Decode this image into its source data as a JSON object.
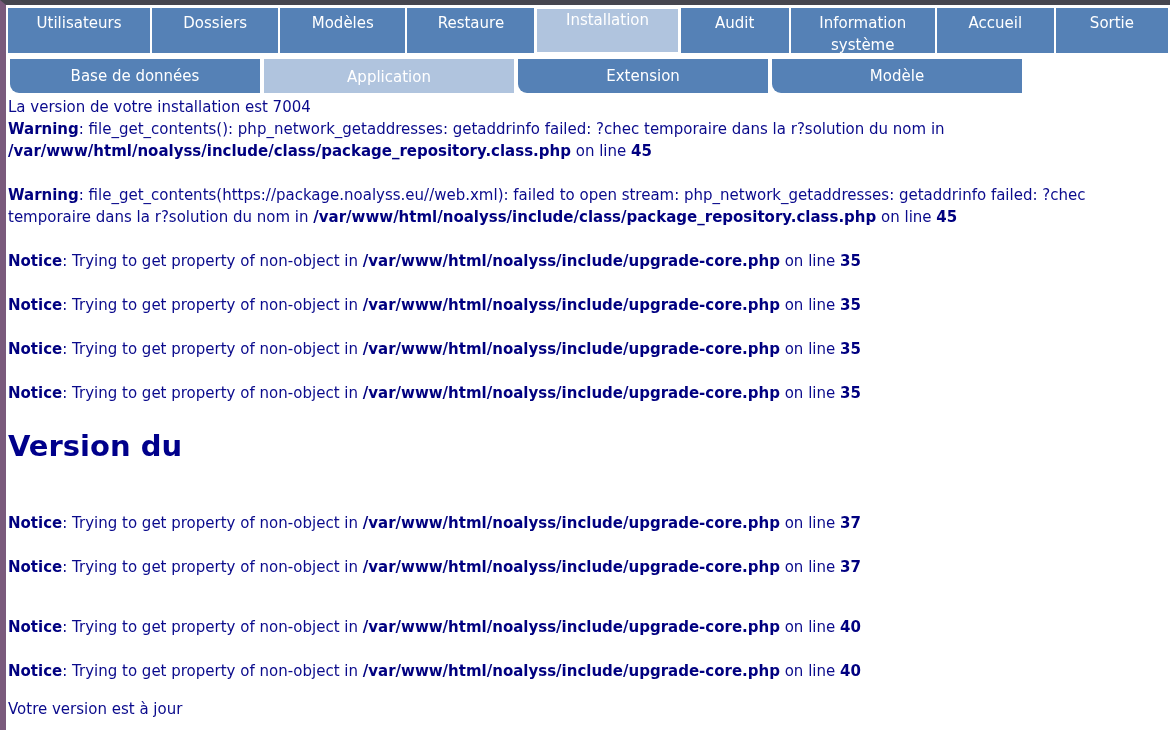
{
  "main_tabs": [
    {
      "label": "Utilisateurs",
      "selected": false
    },
    {
      "label": "Dossiers",
      "selected": false
    },
    {
      "label": "Modèles",
      "selected": false
    },
    {
      "label": "Restaure",
      "selected": false
    },
    {
      "label": "Installation",
      "selected": true
    },
    {
      "label": "Audit",
      "selected": false
    },
    {
      "label": "Information système",
      "selected": false
    },
    {
      "label": "Accueil",
      "selected": false
    },
    {
      "label": "Sortie",
      "selected": false
    }
  ],
  "sub_tabs": [
    {
      "label": "Base de données",
      "selected": false
    },
    {
      "label": "Application",
      "selected": true
    },
    {
      "label": "Extension",
      "selected": false
    },
    {
      "label": "Modèle",
      "selected": false
    }
  ],
  "content": [
    {
      "kind": "text",
      "text": "La version de votre installation est 7004"
    },
    {
      "kind": "messages",
      "items": [
        "**Warning**: file_get_contents(): php_network_getaddresses: getaddrinfo failed: ?chec temporaire dans la r?solution du nom in **/var/www/html/noalyss/include/class/package_repository.class.php** on line **45**",
        "**Warning**: file_get_contents(https://package.noalyss.eu//web.xml): failed to open stream: php_network_getaddresses: getaddrinfo failed: ?chec temporaire dans la r?solution du nom in **/var/www/html/noalyss/include/class/package_repository.class.php** on line **45**",
        "**Notice**: Trying to get property of non-object in **/var/www/html/noalyss/include/upgrade-core.php** on line **35**",
        "**Notice**: Trying to get property of non-object in **/var/www/html/noalyss/include/upgrade-core.php** on line **35**",
        "**Notice**: Trying to get property of non-object in **/var/www/html/noalyss/include/upgrade-core.php** on line **35**",
        "**Notice**: Trying to get property of non-object in **/var/www/html/noalyss/include/upgrade-core.php** on line **35**"
      ]
    },
    {
      "kind": "heading",
      "text": "Version du"
    },
    {
      "kind": "messages",
      "items": [
        "**Notice**: Trying to get property of non-object in **/var/www/html/noalyss/include/upgrade-core.php** on line **37**",
        "**Notice**: Trying to get property of non-object in **/var/www/html/noalyss/include/upgrade-core.php** on line **37**"
      ]
    },
    {
      "kind": "messages",
      "items": [
        "**Notice**: Trying to get property of non-object in **/var/www/html/noalyss/include/upgrade-core.php** on line **40**",
        "**Notice**: Trying to get property of non-object in **/var/www/html/noalyss/include/upgrade-core.php** on line **40**"
      ]
    },
    {
      "kind": "text",
      "text": "Votre version est à jour"
    }
  ]
}
